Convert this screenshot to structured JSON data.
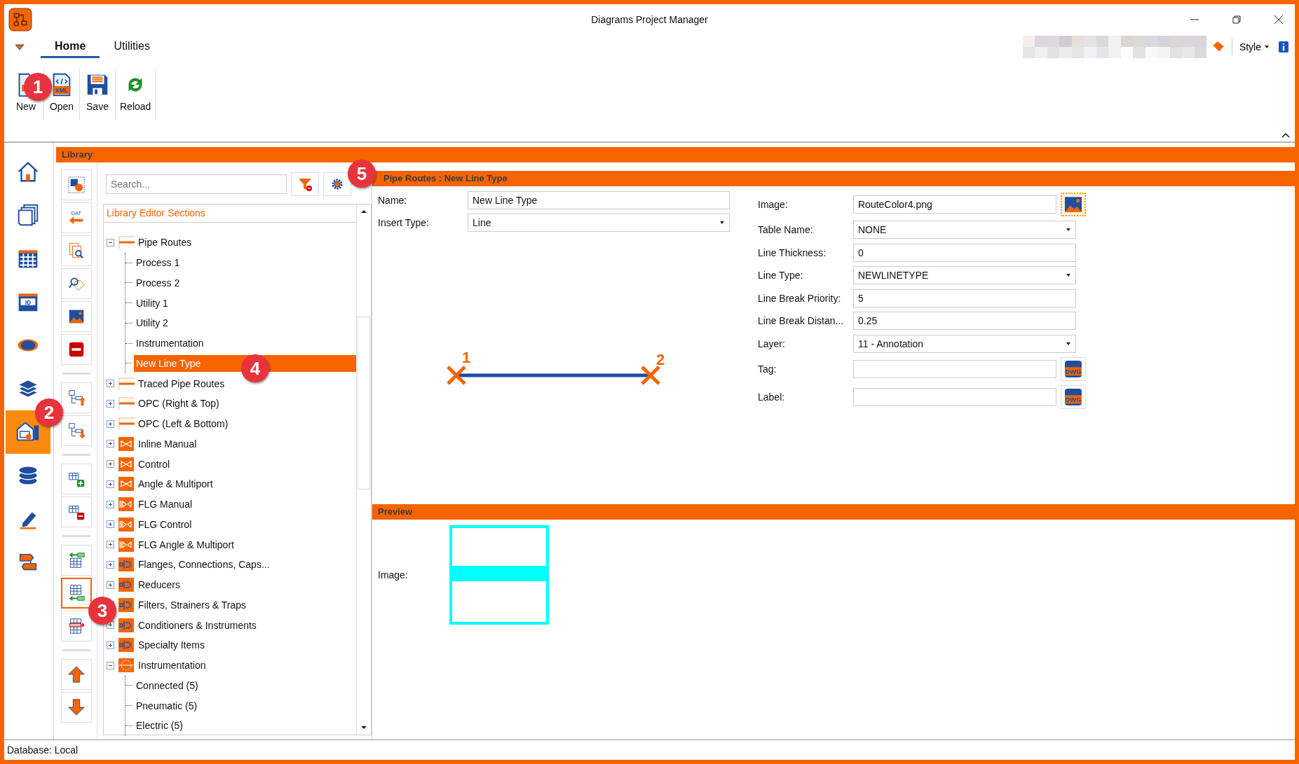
{
  "window": {
    "title": "Diagrams Project Manager"
  },
  "ribbon": {
    "tabs": [
      {
        "label": "Home",
        "selected": true
      },
      {
        "label": "Utilities",
        "selected": false
      }
    ],
    "buttons": [
      {
        "kind": "new",
        "label": "New"
      },
      {
        "kind": "open",
        "label": "Open",
        "glyph": "XML"
      },
      {
        "kind": "save",
        "label": "Save"
      },
      {
        "kind": "reload",
        "label": "Reload"
      }
    ],
    "style_menu": "Style"
  },
  "nav": [
    {
      "kind": "home",
      "selected": false
    },
    {
      "kind": "pages",
      "selected": false
    },
    {
      "kind": "table",
      "selected": false
    },
    {
      "kind": "id-table",
      "selected": false,
      "glyph": "ID"
    },
    {
      "kind": "eye",
      "selected": false
    },
    {
      "kind": "layers",
      "selected": false
    },
    {
      "kind": "library",
      "selected": true
    },
    {
      "kind": "database",
      "selected": false
    },
    {
      "kind": "pen",
      "selected": false
    },
    {
      "kind": "flow",
      "selected": false
    }
  ],
  "library": {
    "title": "Library",
    "tool_groups": [
      [
        {
          "kind": "shapes",
          "selected": false
        },
        {
          "kind": "dat-import",
          "selected": false,
          "glyph": "DAT"
        },
        {
          "kind": "doc-search",
          "selected": false
        },
        {
          "kind": "tag-search",
          "selected": false
        },
        {
          "kind": "image",
          "selected": false
        },
        {
          "kind": "remove",
          "selected": false
        }
      ],
      [
        {
          "kind": "tree-up",
          "selected": false
        },
        {
          "kind": "tree-down",
          "selected": false
        }
      ],
      [
        {
          "kind": "table-add",
          "selected": false
        },
        {
          "kind": "table-remove",
          "selected": false
        }
      ],
      [
        {
          "kind": "table-import",
          "selected": false
        },
        {
          "kind": "table-import-alt",
          "selected": true
        },
        {
          "kind": "table-export",
          "selected": false
        }
      ],
      [
        {
          "kind": "move-up",
          "selected": false
        },
        {
          "kind": "move-down",
          "selected": false
        }
      ]
    ],
    "search": {
      "placeholder": "Search..."
    },
    "tree": {
      "header": "Library Editor Sections",
      "items": [
        {
          "label": "Pipe Routes",
          "kind": "line",
          "expanded": true,
          "selected": false,
          "children": [
            {
              "label": "Process 1",
              "selected": false
            },
            {
              "label": "Process 2",
              "selected": false
            },
            {
              "label": "Utility 1",
              "selected": false
            },
            {
              "label": "Utility 2",
              "selected": false
            },
            {
              "label": "Instrumentation",
              "selected": false
            },
            {
              "label": "New Line Type",
              "selected": true
            }
          ]
        },
        {
          "label": "Traced Pipe Routes",
          "kind": "line",
          "expanded": false,
          "selected": false
        },
        {
          "label": "OPC (Right & Top)",
          "kind": "line",
          "expanded": false,
          "selected": false
        },
        {
          "label": "OPC (Left & Bottom)",
          "kind": "line",
          "expanded": false,
          "selected": false
        },
        {
          "label": "Inline Manual",
          "kind": "valve",
          "expanded": false,
          "selected": false
        },
        {
          "label": "Control",
          "kind": "valve",
          "expanded": false,
          "selected": false
        },
        {
          "label": "Angle & Multiport",
          "kind": "valve",
          "expanded": false,
          "selected": false
        },
        {
          "label": "FLG Manual",
          "kind": "flg",
          "expanded": false,
          "selected": false
        },
        {
          "label": "FLG Control",
          "kind": "flg",
          "expanded": false,
          "selected": false
        },
        {
          "label": "FLG Angle & Multiport",
          "kind": "flg",
          "expanded": false,
          "selected": false
        },
        {
          "label": "Flanges, Connections, Caps...",
          "kind": "fitting",
          "expanded": false,
          "selected": false
        },
        {
          "label": "Reducers",
          "kind": "fitting",
          "expanded": false,
          "selected": false
        },
        {
          "label": "Filters, Strainers & Traps",
          "kind": "fitting",
          "expanded": false,
          "selected": false
        },
        {
          "label": "Conditioners & Instruments",
          "kind": "fitting",
          "expanded": false,
          "selected": false
        },
        {
          "label": "Specialty Items",
          "kind": "fitting",
          "expanded": false,
          "selected": false
        },
        {
          "label": "Instrumentation",
          "kind": "instrument",
          "expanded": true,
          "selected": false,
          "children": [
            {
              "label": "Connected (5)",
              "selected": false
            },
            {
              "label": "Pneumatic (5)",
              "selected": false
            },
            {
              "label": "Electric (5)",
              "selected": false
            }
          ]
        }
      ]
    }
  },
  "editor": {
    "title": "Pipe Routes : New Line Type",
    "left_fields": [
      {
        "label": "Name:",
        "value": "New Line Type",
        "kind": "text"
      },
      {
        "label": "Insert Type:",
        "value": "Line",
        "kind": "select"
      }
    ],
    "endpoints": [
      "1",
      "2"
    ],
    "right_fields": [
      {
        "label": "Image:",
        "value": "RouteColor4.png",
        "kind": "image-browse"
      },
      {
        "label": "Table Name:",
        "value": "NONE",
        "kind": "select"
      },
      {
        "label": "Line Thickness:",
        "value": "0",
        "kind": "text"
      },
      {
        "label": "Line Type:",
        "value": "NEWLINETYPE",
        "kind": "select"
      },
      {
        "label": "Line Break Priority:",
        "value": "5",
        "kind": "text"
      },
      {
        "label": "Line Break Distan...",
        "value": "0.25",
        "kind": "text"
      },
      {
        "label": "Layer:",
        "value": "11 - Annotation",
        "kind": "select"
      },
      {
        "label": "Tag:",
        "kind": "dwg-browse",
        "glyph": "DWG"
      },
      {
        "label": "Label:",
        "kind": "dwg-browse",
        "glyph": "DWG"
      }
    ]
  },
  "preview": {
    "title": "Preview",
    "image_label": "Image:"
  },
  "callouts": [
    "1",
    "2",
    "3",
    "4",
    "5"
  ],
  "status_bar": "Database: Local"
}
